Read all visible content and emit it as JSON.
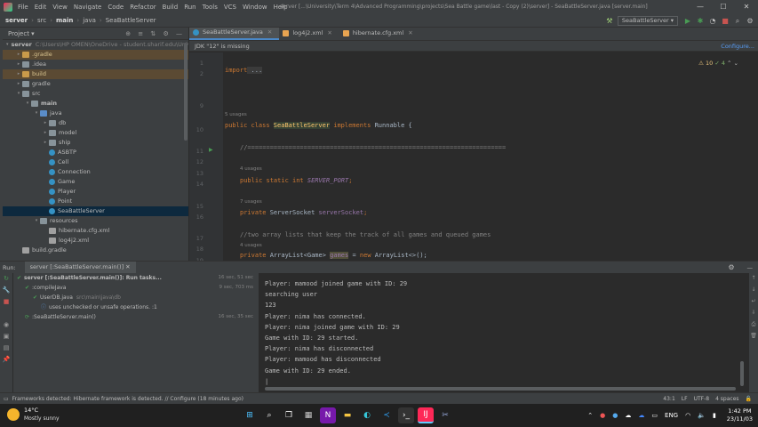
{
  "window": {
    "title": "server [...\\University\\Term 4\\Advanced Programming\\projects\\Sea Battle game\\last - Copy (2)\\server] - SeaBattleServer.java [server.main]",
    "menu": [
      "File",
      "Edit",
      "View",
      "Navigate",
      "Code",
      "Refactor",
      "Build",
      "Run",
      "Tools",
      "VCS",
      "Window",
      "Help"
    ],
    "controls": [
      "—",
      "☐",
      "✕"
    ]
  },
  "navbar": {
    "crumbs": [
      "server",
      "src",
      "main",
      "java",
      "SeaBattleServer"
    ],
    "run_config": "SeaBattleServer ▾"
  },
  "project": {
    "header": "Project ▾",
    "tree": [
      {
        "label": "server",
        "hint": "C:\\Users\\HP OMEN\\OneDrive - student.sharif.edu\\Unive",
        "indent": 0,
        "arrow": "▾",
        "icon": "folder",
        "style": "bold"
      },
      {
        "label": ".gradle",
        "indent": 1,
        "arrow": "▸",
        "icon": "folder-o",
        "style": "orange"
      },
      {
        "label": ".idea",
        "indent": 1,
        "arrow": "▸",
        "icon": "folder",
        "style": ""
      },
      {
        "label": "build",
        "indent": 1,
        "arrow": "▸",
        "icon": "folder-o",
        "style": "orange"
      },
      {
        "label": "gradle",
        "indent": 1,
        "arrow": "▸",
        "icon": "folder",
        "style": ""
      },
      {
        "label": "src",
        "indent": 1,
        "arrow": "▾",
        "icon": "folder",
        "style": ""
      },
      {
        "label": "main",
        "indent": 2,
        "arrow": "▾",
        "icon": "folder",
        "style": "bold"
      },
      {
        "label": "java",
        "indent": 3,
        "arrow": "▾",
        "icon": "folder-b",
        "style": ""
      },
      {
        "label": "db",
        "indent": 4,
        "arrow": "▸",
        "icon": "folder",
        "style": ""
      },
      {
        "label": "model",
        "indent": 4,
        "arrow": "▸",
        "icon": "folder",
        "style": ""
      },
      {
        "label": "ship",
        "indent": 4,
        "arrow": "▸",
        "icon": "folder",
        "style": ""
      },
      {
        "label": "ASBTP",
        "indent": 4,
        "arrow": "",
        "icon": "class",
        "style": ""
      },
      {
        "label": "Cell",
        "indent": 4,
        "arrow": "",
        "icon": "class",
        "style": ""
      },
      {
        "label": "Connection",
        "indent": 4,
        "arrow": "",
        "icon": "class",
        "style": ""
      },
      {
        "label": "Game",
        "indent": 4,
        "arrow": "",
        "icon": "class",
        "style": ""
      },
      {
        "label": "Player",
        "indent": 4,
        "arrow": "",
        "icon": "class",
        "style": ""
      },
      {
        "label": "Point",
        "indent": 4,
        "arrow": "",
        "icon": "class",
        "style": ""
      },
      {
        "label": "SeaBattleServer",
        "indent": 4,
        "arrow": "",
        "icon": "class",
        "style": "sel"
      },
      {
        "label": "resources",
        "indent": 3,
        "arrow": "▾",
        "icon": "folder",
        "style": ""
      },
      {
        "label": "hibernate.cfg.xml",
        "indent": 4,
        "arrow": "",
        "icon": "file",
        "style": ""
      },
      {
        "label": "log4j2.xml",
        "indent": 4,
        "arrow": "",
        "icon": "file",
        "style": ""
      },
      {
        "label": "build.gradle",
        "indent": 1,
        "arrow": "",
        "icon": "file",
        "style": ""
      }
    ]
  },
  "editor": {
    "tabs": [
      {
        "label": "SeaBattleServer.java",
        "type": "java",
        "active": true
      },
      {
        "label": "log4j2.xml",
        "type": "xml",
        "active": false
      },
      {
        "label": "hibernate.cfg.xml",
        "type": "xml",
        "active": false
      }
    ],
    "jdk_warning": "JDK \"12\" is missing",
    "configure_link": "Configure...",
    "warnings_badge": {
      "warnings": "⚠ 10",
      "checks": "✓ 4"
    },
    "line_numbers": [
      "1",
      "2",
      "9",
      "10",
      "11",
      "12",
      "13",
      "14",
      "15",
      "16",
      "17",
      "18",
      "19",
      "20"
    ],
    "usages": [
      "5 usages",
      "4 usages",
      "7 usages",
      "4 usages"
    ],
    "code": {
      "import_kw": "import",
      "import_dots": " ...",
      "class_line_public": "public class ",
      "class_line_name": "SeaBattleServer",
      "class_line_impl": " implements ",
      "class_line_runnable": "Runnable {",
      "comment1": "//=====================================================================",
      "field1_mods": "public static int ",
      "field1_name": "SERVER_PORT",
      "field1_end": ";",
      "field2_mods": "private ",
      "field2_type": "ServerSocket ",
      "field2_name": "serverSocket",
      "field2_end": ";",
      "comment2": "//two array lists that keep the track of all games and queued games",
      "field3_mods": "private ",
      "field3_type": "ArrayList<Game> ",
      "field3_name": "games",
      "field3_mid": " = ",
      "field3_new": "new ",
      "field3_end": "ArrayList<>();"
    }
  },
  "run": {
    "label": "Run:",
    "tab": "server [:SeaBattleServer.main()] ✕",
    "tree": [
      {
        "label": "server [:SeaBattleServer.main()]: Run tasks...",
        "time": "16 sec, 51 sec",
        "indent": 0,
        "mark": "ok"
      },
      {
        "label": ":compileJava",
        "time": "9 sec, 703 ms",
        "indent": 1,
        "mark": "ok"
      },
      {
        "label": "UserDB.java",
        "hint": "src\\main\\java\\db",
        "time": "",
        "indent": 2,
        "mark": "ok"
      },
      {
        "label": "uses unchecked or unsafe operations. :1",
        "time": "",
        "indent": 3,
        "mark": "info"
      },
      {
        "label": ":SeaBattleServer.main()",
        "time": "16 sec, 35 sec",
        "indent": 1,
        "mark": "run"
      }
    ],
    "console": [
      "Player: mamood joined game with ID: 29",
      "searching user",
      "123",
      "Player: nima has connected.",
      "Player: nima joined game with ID: 29",
      "Game with ID: 29 started.",
      "Player: nima has disconnected",
      "Player: mamood has disconnected",
      "Game with ID: 29 ended.",
      "|"
    ]
  },
  "status": {
    "message": "Frameworks detected: Hibernate framework is detected. // Configure (18 minutes ago)",
    "position": "43:1",
    "line_sep": "LF",
    "encoding": "UTF-8",
    "indent": "4 spaces"
  },
  "taskbar": {
    "weather_temp": "14°C",
    "weather_desc": "Mostly sunny",
    "language": "ENG",
    "time": "1:42 PM",
    "date": "23/11/03"
  },
  "colors": {
    "accent": "#4a88c7",
    "keyword": "#cc7832",
    "field": "#9876aa",
    "class": "#ffc66d"
  }
}
